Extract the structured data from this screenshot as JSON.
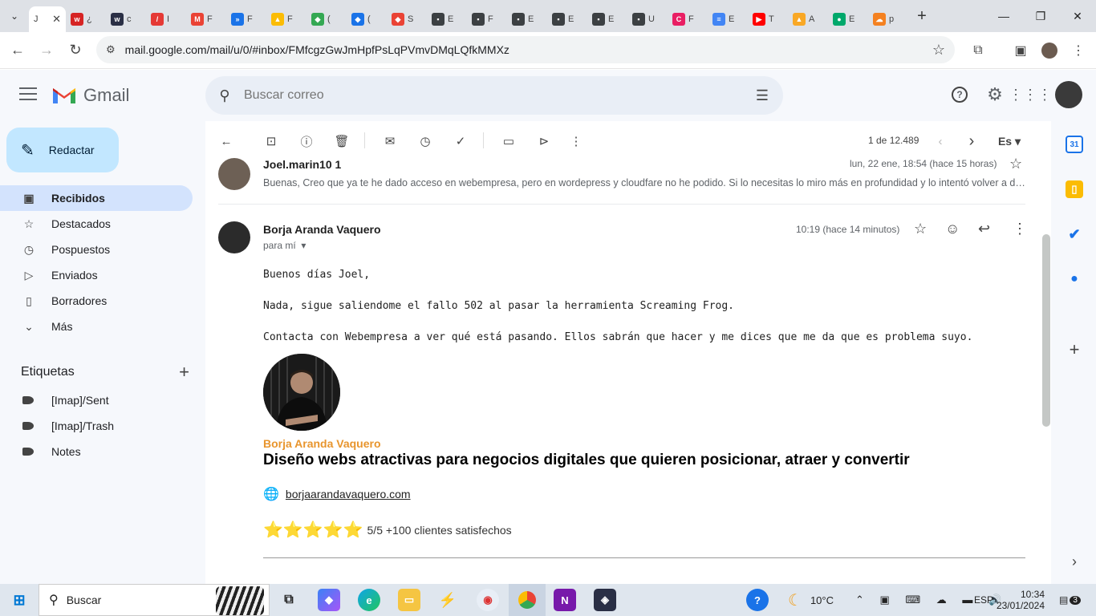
{
  "browser": {
    "active_tab": "J",
    "other_tabs": [
      {
        "icon": "w",
        "color": "#d62424",
        "label": "¿"
      },
      {
        "icon": "w",
        "color": "#2a2f45",
        "label": "c"
      },
      {
        "icon": "/",
        "color": "#e53935",
        "label": "I"
      },
      {
        "icon": "M",
        "color": "#ea4335",
        "label": "F"
      },
      {
        "icon": "»",
        "color": "#1a73e8",
        "label": "F"
      },
      {
        "icon": "▲",
        "color": "#fbbc04",
        "label": "F"
      },
      {
        "icon": "◆",
        "color": "#34a853",
        "label": "("
      },
      {
        "icon": "◆",
        "color": "#1a73e8",
        "label": "("
      },
      {
        "icon": "◆",
        "color": "#ea4335",
        "label": "S"
      },
      {
        "icon": "▪",
        "color": "#3c4043",
        "label": "E"
      },
      {
        "icon": "▪",
        "color": "#3c4043",
        "label": "F"
      },
      {
        "icon": "▪",
        "color": "#3c4043",
        "label": "E"
      },
      {
        "icon": "▪",
        "color": "#3c4043",
        "label": "E"
      },
      {
        "icon": "▪",
        "color": "#3c4043",
        "label": "E"
      },
      {
        "icon": "▪",
        "color": "#3c4043",
        "label": "U"
      },
      {
        "icon": "C",
        "color": "#e91e63",
        "label": "F"
      },
      {
        "icon": "≡",
        "color": "#4285f4",
        "label": "E"
      },
      {
        "icon": "▶",
        "color": "#ff0000",
        "label": "T"
      },
      {
        "icon": "▲",
        "color": "#f9a825",
        "label": "A"
      },
      {
        "icon": "●",
        "color": "#00a86b",
        "label": "E"
      },
      {
        "icon": "☁",
        "color": "#f48120",
        "label": "p"
      }
    ],
    "url": "mail.google.com/mail/u/0/#inbox/FMfcgzGwJmHpfPsLqPVmvDMqLQfkMMXz"
  },
  "gmail": {
    "brand": "Gmail",
    "search_placeholder": "Buscar correo",
    "compose_label": "Redactar",
    "nav": [
      {
        "label": "Recibidos",
        "icon": "inbox-icon",
        "selected": true
      },
      {
        "label": "Destacados",
        "icon": "star-icon",
        "selected": false
      },
      {
        "label": "Pospuestos",
        "icon": "clock-icon",
        "selected": false
      },
      {
        "label": "Enviados",
        "icon": "send-icon",
        "selected": false
      },
      {
        "label": "Borradores",
        "icon": "draft-icon",
        "selected": false
      },
      {
        "label": "Más",
        "icon": "chevron-down-icon",
        "selected": false
      }
    ],
    "labels_title": "Etiquetas",
    "labels": [
      "[Imap]/Sent",
      "[Imap]/Trash",
      "Notes"
    ],
    "pager": "1 de 12.489",
    "lang": "Es"
  },
  "thread": {
    "prev_message": {
      "sender": "Joel.marin10 1",
      "date": "lun, 22 ene, 18:54 (hace 15 horas)",
      "snippet": "Buenas, Creo que ya te he dado acceso en webempresa, pero en wordepress y cloudfare no he podido. Si lo necesitas lo miro más en profundidad y lo intentó volver a dar."
    },
    "current_message": {
      "sender": "Borja Aranda Vaquero",
      "to": "para mí",
      "date": "10:19 (hace 14 minutos)",
      "lines": [
        "Buenos días Joel,",
        "Nada, sigue saliendome el fallo 502 al pasar la herramienta Screaming Frog.",
        "Contacta con Webempresa a ver qué está pasando. Ellos sabrán que hacer y me dices que me da que es problema suyo."
      ],
      "signature": {
        "name": "Borja Aranda Vaquero",
        "tagline": "Diseño webs atractivas para negocios digitales que quieren posicionar, atraer y convertir",
        "website": "borjaarandavaquero.com",
        "stars": "⭐⭐⭐⭐⭐",
        "rating": "5/5 +100 clientes satisfechos"
      }
    }
  },
  "taskbar": {
    "search": "Buscar",
    "weather": "10°C",
    "lang": "ESP",
    "time": "10:34",
    "date": "23/01/2024",
    "notifications": "3"
  }
}
